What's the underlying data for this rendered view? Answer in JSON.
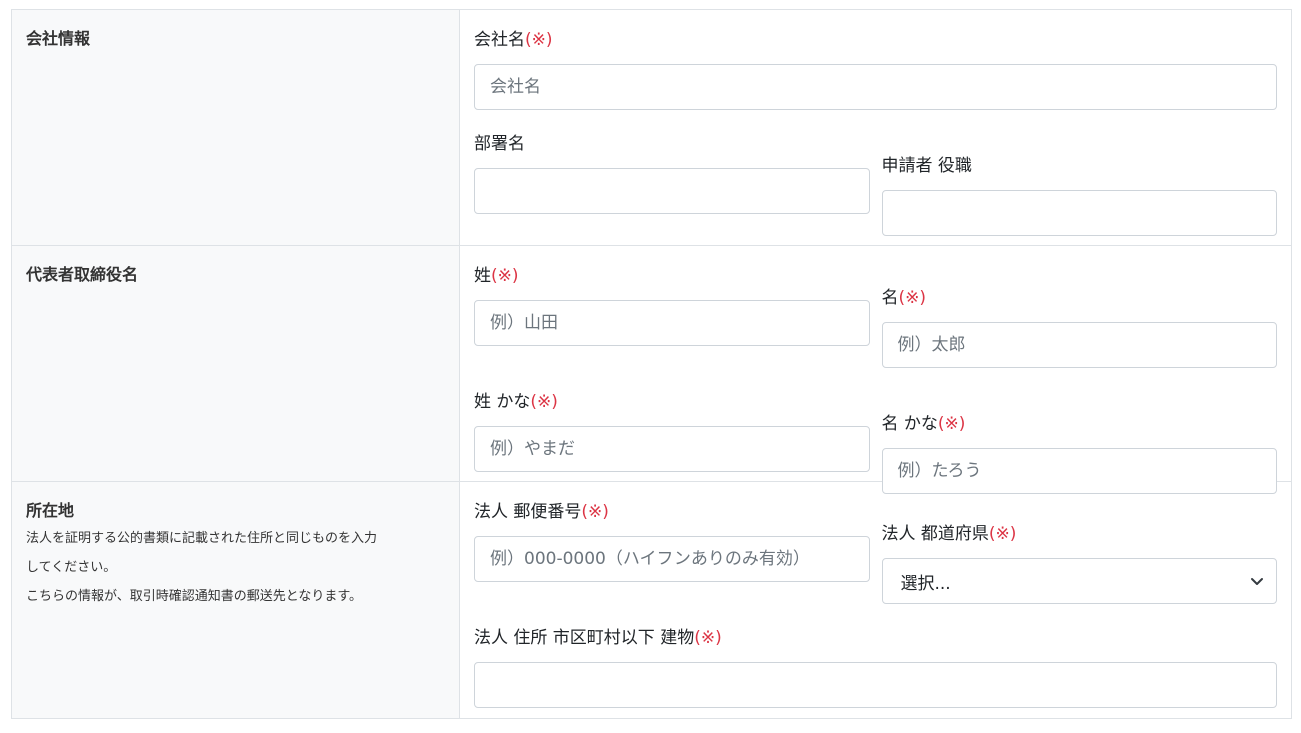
{
  "required_mark": "(※)",
  "company": {
    "section_title": "会社情報",
    "company_name": {
      "label": "会社名",
      "placeholder": "会社名"
    },
    "department": {
      "label": "部署名",
      "placeholder": ""
    },
    "applicant_title": {
      "label": "申請者 役職",
      "placeholder": ""
    }
  },
  "representative": {
    "section_title": "代表者取締役名",
    "last_name": {
      "label": "姓",
      "placeholder": "例）山田"
    },
    "first_name": {
      "label": "名",
      "placeholder": "例）太郎"
    },
    "last_name_kana": {
      "label": "姓 かな",
      "placeholder": "例）やまだ"
    },
    "first_name_kana": {
      "label": "名 かな",
      "placeholder": "例）たろう"
    }
  },
  "address": {
    "section_title": "所在地",
    "notes": [
      "法人を証明する公的書類に記載された住所と同じものを入力",
      "してください。",
      "こちらの情報が、取引時確認通知書の郵送先となります。"
    ],
    "postal_code": {
      "label": "法人 郵便番号",
      "placeholder": "例）000-0000（ハイフンありのみ有効）"
    },
    "prefecture": {
      "label": "法人 都道府県",
      "selected": "選択..."
    },
    "street": {
      "label": "法人 住所 市区町村以下 建物",
      "placeholder": ""
    }
  },
  "colors": {
    "required": "#dc3545",
    "side_bg": "#f8f9fa",
    "border": "#dee2e6"
  }
}
